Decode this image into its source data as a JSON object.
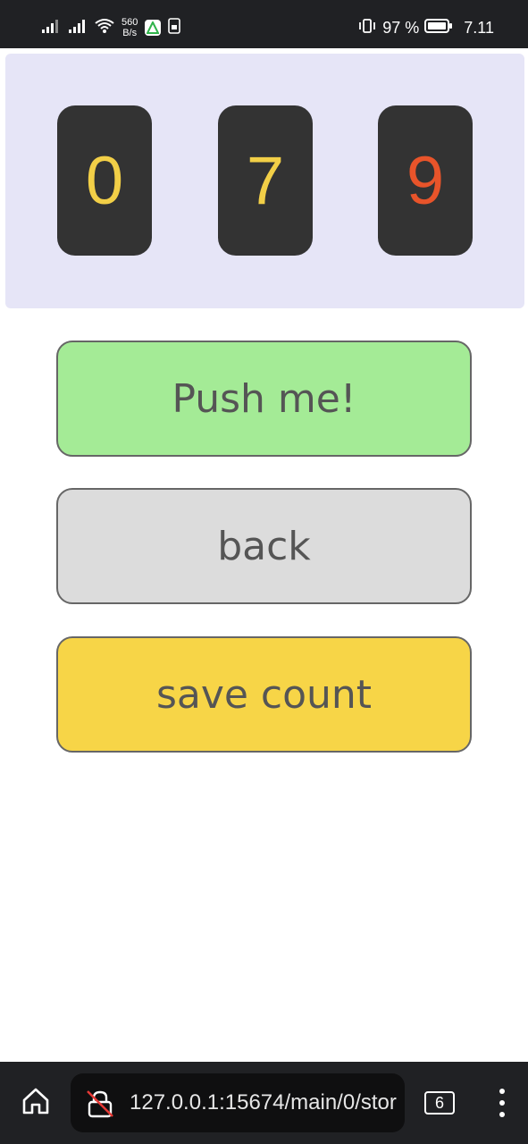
{
  "status_bar": {
    "net_speed_value": "560",
    "net_speed_unit": "B/s",
    "app_badge": "A",
    "battery_percent": "97 %",
    "time": "7.11"
  },
  "counter": {
    "digits": [
      {
        "value": "0",
        "color": "#f2cf47"
      },
      {
        "value": "7",
        "color": "#f2cf47"
      },
      {
        "value": "9",
        "color": "#e8542a"
      }
    ]
  },
  "buttons": {
    "push_label": "Push me!",
    "back_label": "back",
    "save_label": "save count"
  },
  "browser": {
    "url": "127.0.0.1:15674/main/0/stor",
    "tab_count": "6"
  },
  "colors": {
    "panel_bg": "#e6e5f7",
    "push_bg": "#a4eb96",
    "back_bg": "#dcdcdc",
    "save_bg": "#f7d547",
    "digit_card_bg": "#333333"
  }
}
